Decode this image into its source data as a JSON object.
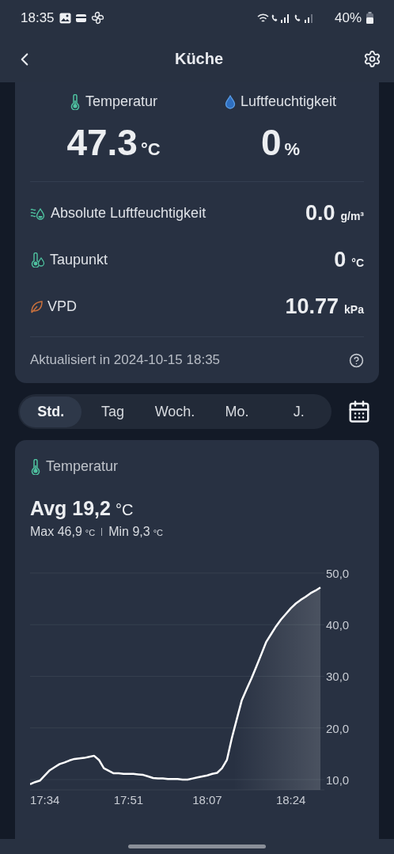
{
  "status_bar": {
    "time": "18:35",
    "battery": "40%"
  },
  "header": {
    "title": "Küche"
  },
  "current": {
    "primary": [
      {
        "kind": "temperature",
        "label": "Temperatur",
        "value": "47.3",
        "unit": "°C"
      },
      {
        "kind": "humidity",
        "label": "Luftfeuchtigkeit",
        "value": "0",
        "unit": "%"
      }
    ],
    "details": [
      {
        "kind": "absolute-humidity",
        "label": "Absolute Luftfeuchtigkeit",
        "value": "0.0",
        "unit": "g/m³"
      },
      {
        "kind": "dew-point",
        "label": "Taupunkt",
        "value": "0",
        "unit": "°C"
      },
      {
        "kind": "vpd",
        "label": "VPD",
        "value": "10.77",
        "unit": "kPa"
      }
    ],
    "updated": "Aktualisiert in 2024-10-15 18:35"
  },
  "periods": [
    {
      "label": "Std.",
      "selected": true
    },
    {
      "label": "Tag",
      "selected": false
    },
    {
      "label": "Woch.",
      "selected": false
    },
    {
      "label": "Mo.",
      "selected": false
    },
    {
      "label": "J.",
      "selected": false
    }
  ],
  "history": {
    "title": "Temperatur",
    "avg_label": "Avg",
    "avg": "19,2",
    "unit": "°C",
    "max_label": "Max",
    "max": "46,9",
    "max_unit": "°C",
    "min_label": "Min",
    "min": "9,3",
    "min_unit": "°C",
    "chart_data": {
      "type": "area",
      "grid": true,
      "categories": [
        null,
        null,
        null,
        "17:34",
        null,
        null,
        null,
        null,
        null,
        null,
        null,
        null,
        null,
        null,
        null,
        null,
        null,
        null,
        null,
        null,
        "17:51",
        null,
        null,
        null,
        null,
        null,
        null,
        null,
        null,
        null,
        null,
        null,
        null,
        null,
        null,
        null,
        "18:07",
        null,
        null,
        null,
        null,
        null,
        null,
        null,
        null,
        null,
        null,
        null,
        null,
        null,
        null,
        null,
        null,
        "18:24",
        null,
        null,
        null,
        null,
        null,
        null
      ],
      "series": [
        {
          "color": "#ffffff",
          "values": [
            9.1,
            9.5,
            9.8,
            10.8,
            11.8,
            12.4,
            13.0,
            13.3,
            13.7,
            14.0,
            14.1,
            14.2,
            14.4,
            14.6,
            13.8,
            12.2,
            11.7,
            11.2,
            11.2,
            11.1,
            11.1,
            11.1,
            11.0,
            10.9,
            10.6,
            10.3,
            10.2,
            10.2,
            10.1,
            10.1,
            10.1,
            10.0,
            10.0,
            10.2,
            10.4,
            10.6,
            10.8,
            11.1,
            11.3,
            12.2,
            13.8,
            18.0,
            21.7,
            25.3,
            27.5,
            29.6,
            31.9,
            34.3,
            36.7,
            38.2,
            39.7,
            41.0,
            42.1,
            43.2,
            44.1,
            44.8,
            45.4,
            46.1,
            46.6,
            47.2
          ]
        }
      ],
      "ylim": [
        8,
        50
      ],
      "yticks": [
        {
          "value": 10,
          "label": "10,0"
        },
        {
          "value": 20,
          "label": "20,0"
        },
        {
          "value": 30,
          "label": "30,0"
        },
        {
          "value": 40,
          "label": "40,0"
        },
        {
          "value": 50,
          "label": "50,0"
        }
      ]
    }
  }
}
